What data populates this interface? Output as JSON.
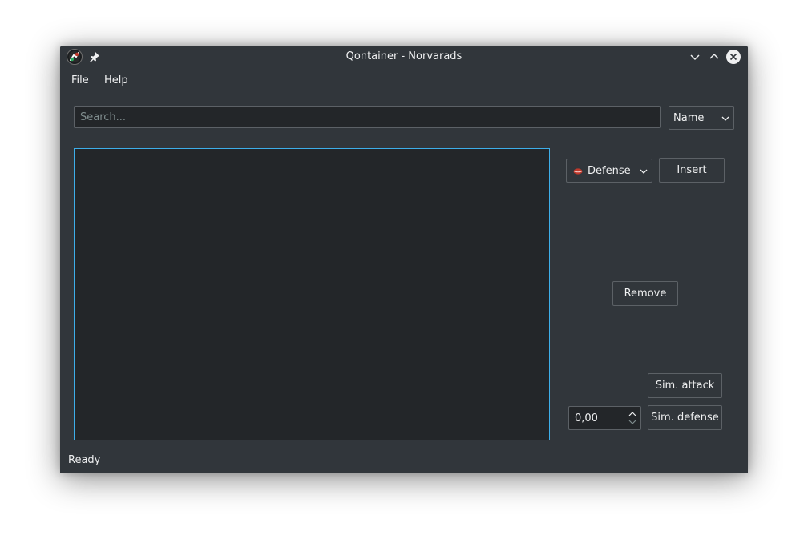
{
  "window": {
    "title": "Qontainer - Norvarads",
    "app_icon": "qontainer-app-icon",
    "pin_icon": "pin-icon"
  },
  "titlebar_buttons": [
    "minimize-icon",
    "maximize-icon",
    "close-icon"
  ],
  "menubar": {
    "items": [
      {
        "label": "File"
      },
      {
        "label": "Help"
      }
    ]
  },
  "search": {
    "placeholder": "Search...",
    "value": "",
    "sort_selected": "Name"
  },
  "type_select": {
    "selected": "Defense",
    "icon": "lips-icon"
  },
  "buttons": {
    "insert": "Insert",
    "remove": "Remove",
    "sim_attack": "Sim. attack",
    "sim_defense": "Sim. defense"
  },
  "spinbox": {
    "value": "0,00"
  },
  "status": {
    "text": "Ready"
  },
  "colors": {
    "window_bg": "#31363b",
    "view_bg": "#232629",
    "focus": "#3daee9",
    "border": "#5c6166",
    "text": "#eff0f1"
  }
}
